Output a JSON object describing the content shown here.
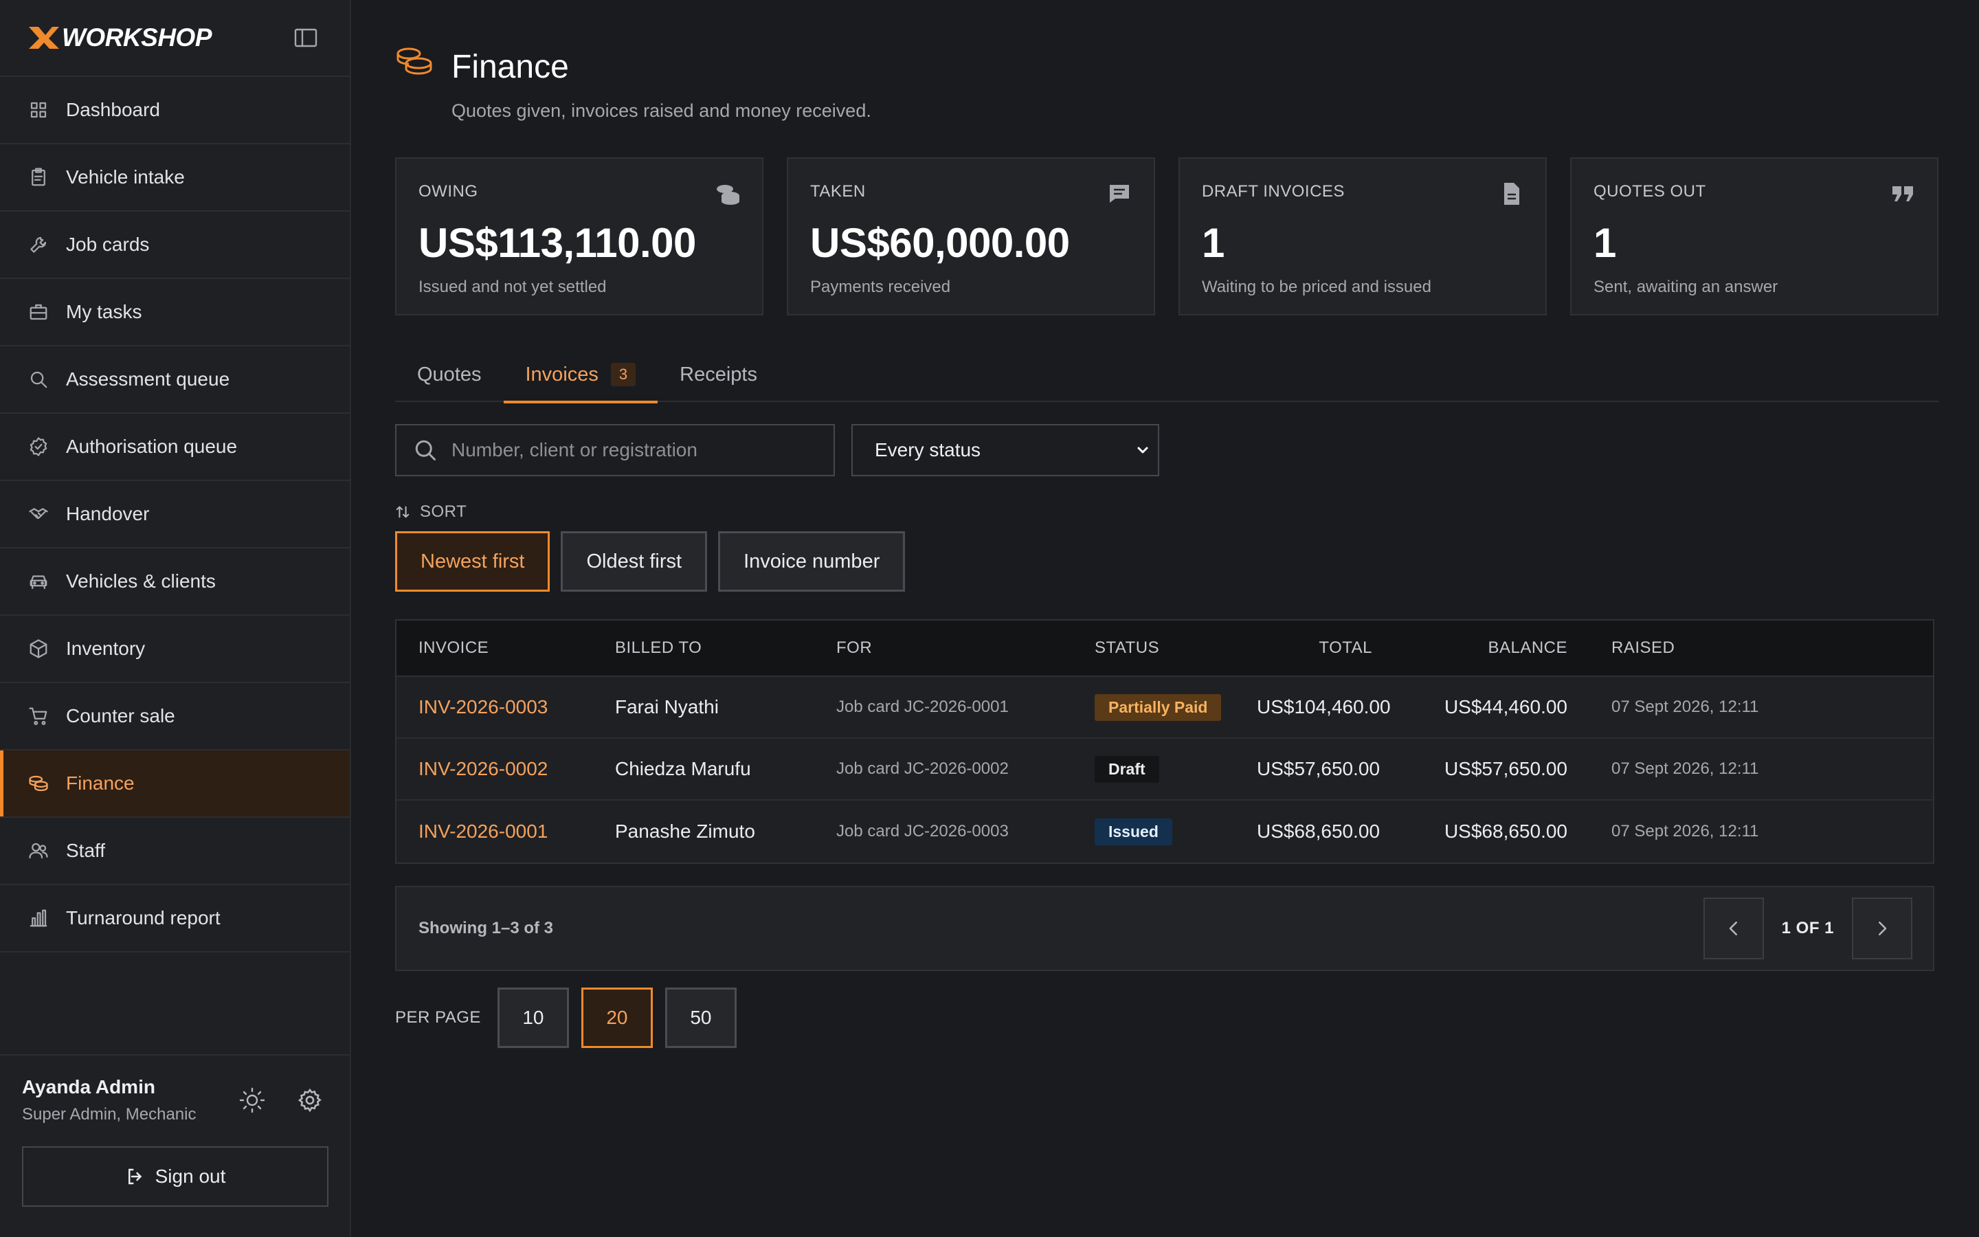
{
  "brand": {
    "logo_text": "WORKSHOP"
  },
  "sidebar": {
    "items": [
      {
        "label": "Dashboard",
        "icon": "grid-icon"
      },
      {
        "label": "Vehicle intake",
        "icon": "clipboard-icon"
      },
      {
        "label": "Job cards",
        "icon": "wrench-icon"
      },
      {
        "label": "My tasks",
        "icon": "briefcase-icon"
      },
      {
        "label": "Assessment queue",
        "icon": "search-icon"
      },
      {
        "label": "Authorisation queue",
        "icon": "badge-check-icon"
      },
      {
        "label": "Handover",
        "icon": "handshake-icon"
      },
      {
        "label": "Vehicles & clients",
        "icon": "car-icon"
      },
      {
        "label": "Inventory",
        "icon": "box-icon"
      },
      {
        "label": "Counter sale",
        "icon": "cart-icon"
      },
      {
        "label": "Finance",
        "icon": "coins-icon",
        "active": true
      },
      {
        "label": "Staff",
        "icon": "users-icon"
      },
      {
        "label": "Turnaround report",
        "icon": "bar-chart-icon"
      }
    ]
  },
  "user": {
    "name": "Ayanda Admin",
    "role": "Super Admin, Mechanic",
    "signout_label": "Sign out"
  },
  "page": {
    "title": "Finance",
    "subtitle": "Quotes given, invoices raised and money received."
  },
  "stats": [
    {
      "label": "OWING",
      "value": "US$113,110.00",
      "desc": "Issued and not yet settled",
      "icon": "coins-icon"
    },
    {
      "label": "TAKEN",
      "value": "US$60,000.00",
      "desc": "Payments received",
      "icon": "message-icon"
    },
    {
      "label": "DRAFT INVOICES",
      "value": "1",
      "desc": "Waiting to be priced and issued",
      "icon": "document-icon"
    },
    {
      "label": "QUOTES OUT",
      "value": "1",
      "desc": "Sent, awaiting an answer",
      "icon": "quote-icon"
    }
  ],
  "tabs": [
    {
      "label": "Quotes"
    },
    {
      "label": "Invoices",
      "badge": "3",
      "active": true
    },
    {
      "label": "Receipts"
    }
  ],
  "filters": {
    "search_placeholder": "Number, client or registration",
    "status_selected": "Every status"
  },
  "sort": {
    "label": "SORT",
    "options": [
      "Newest first",
      "Oldest first",
      "Invoice number"
    ],
    "active": "Newest first"
  },
  "table": {
    "headers": [
      "INVOICE",
      "BILLED TO",
      "FOR",
      "STATUS",
      "TOTAL",
      "BALANCE",
      "RAISED"
    ],
    "rows": [
      {
        "invoice": "INV-2026-0003",
        "billed_to": "Farai Nyathi",
        "for": "Job card JC-2026-0001",
        "status": "Partially Paid",
        "total": "US$104,460.00",
        "balance": "US$44,460.00",
        "raised": "07 Sept 2026, 12:11"
      },
      {
        "invoice": "INV-2026-0002",
        "billed_to": "Chiedza Marufu",
        "for": "Job card JC-2026-0002",
        "status": "Draft",
        "total": "US$57,650.00",
        "balance": "US$57,650.00",
        "raised": "07 Sept 2026, 12:11"
      },
      {
        "invoice": "INV-2026-0001",
        "billed_to": "Panashe Zimuto",
        "for": "Job card JC-2026-0003",
        "status": "Issued",
        "total": "US$68,650.00",
        "balance": "US$68,650.00",
        "raised": "07 Sept 2026, 12:11"
      }
    ]
  },
  "pagination": {
    "showing": "Showing 1–3 of 3",
    "page_text": "1 OF 1"
  },
  "per_page": {
    "label": "PER PAGE",
    "options": [
      "10",
      "20",
      "50"
    ],
    "active": "20"
  },
  "colors": {
    "accent": "#f08a2c",
    "background": "#1a1b1e",
    "sidebar": "#1f2023"
  }
}
